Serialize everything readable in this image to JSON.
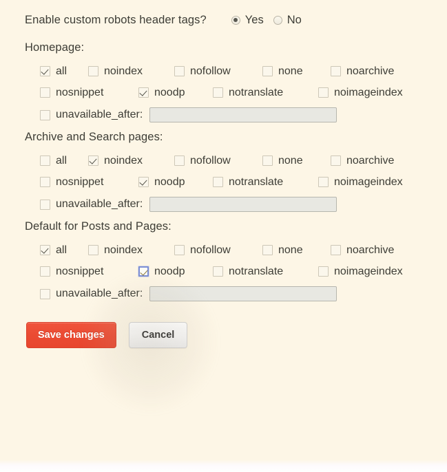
{
  "colors": {
    "background": "#fdf6e6",
    "text": "#3d3d36",
    "primary_button": "#ea4a32",
    "input_fill": "#e8e8e2",
    "focus_ring": "#7c8fd6"
  },
  "header": {
    "question": "Enable custom robots header tags?",
    "options": [
      {
        "label": "Yes",
        "selected": true
      },
      {
        "label": "No",
        "selected": false
      }
    ]
  },
  "sections": [
    {
      "title": "Homepage:",
      "row1": [
        {
          "label": "all",
          "checked": true,
          "focused": false
        },
        {
          "label": "noindex",
          "checked": false,
          "focused": false
        },
        {
          "label": "nofollow",
          "checked": false,
          "focused": false
        },
        {
          "label": "none",
          "checked": false,
          "focused": false
        },
        {
          "label": "noarchive",
          "checked": false,
          "focused": false
        }
      ],
      "row2": [
        {
          "label": "nosnippet",
          "checked": false,
          "focused": false
        },
        {
          "label": "noodp",
          "checked": true,
          "focused": false
        },
        {
          "label": "notranslate",
          "checked": false,
          "focused": false
        },
        {
          "label": "noimageindex",
          "checked": false,
          "focused": false
        }
      ],
      "date": {
        "label": "unavailable_after:",
        "checked": false,
        "value": "",
        "placeholder": ""
      }
    },
    {
      "title": "Archive and Search pages:",
      "row1": [
        {
          "label": "all",
          "checked": false,
          "focused": false
        },
        {
          "label": "noindex",
          "checked": true,
          "focused": false
        },
        {
          "label": "nofollow",
          "checked": false,
          "focused": false
        },
        {
          "label": "none",
          "checked": false,
          "focused": false
        },
        {
          "label": "noarchive",
          "checked": false,
          "focused": false
        }
      ],
      "row2": [
        {
          "label": "nosnippet",
          "checked": false,
          "focused": false
        },
        {
          "label": "noodp",
          "checked": true,
          "focused": false
        },
        {
          "label": "notranslate",
          "checked": false,
          "focused": false
        },
        {
          "label": "noimageindex",
          "checked": false,
          "focused": false
        }
      ],
      "date": {
        "label": "unavailable_after:",
        "checked": false,
        "value": "",
        "placeholder": ""
      }
    },
    {
      "title": "Default for Posts and Pages:",
      "row1": [
        {
          "label": "all",
          "checked": true,
          "focused": false
        },
        {
          "label": "noindex",
          "checked": false,
          "focused": false
        },
        {
          "label": "nofollow",
          "checked": false,
          "focused": false
        },
        {
          "label": "none",
          "checked": false,
          "focused": false
        },
        {
          "label": "noarchive",
          "checked": false,
          "focused": false
        }
      ],
      "row2": [
        {
          "label": "nosnippet",
          "checked": false,
          "focused": false
        },
        {
          "label": "noodp",
          "checked": true,
          "focused": true
        },
        {
          "label": "notranslate",
          "checked": false,
          "focused": false
        },
        {
          "label": "noimageindex",
          "checked": false,
          "focused": false
        }
      ],
      "date": {
        "label": "unavailable_after:",
        "checked": false,
        "value": "",
        "placeholder": ""
      }
    }
  ],
  "buttons": {
    "save_label": "Save changes",
    "cancel_label": "Cancel"
  }
}
